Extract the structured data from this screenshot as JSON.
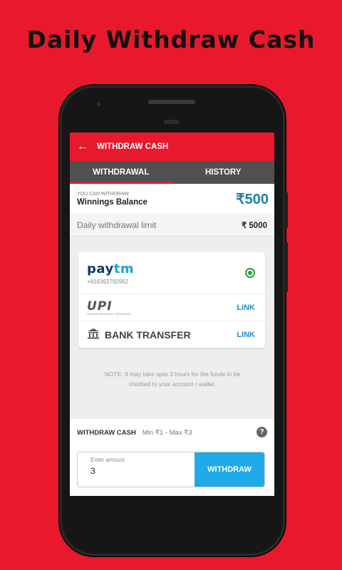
{
  "headline": "Daily Withdraw Cash",
  "appbar": {
    "back_icon": "arrow-left-icon",
    "title": "WITHDRAW CASH"
  },
  "tabs": [
    {
      "label": "WITHDRAWAL",
      "active": true
    },
    {
      "label": "HISTORY",
      "active": false
    }
  ],
  "balance": {
    "caption": "YOU CAN WITHDRAW",
    "label": "Winnings Balance",
    "amount": "₹500"
  },
  "limit": {
    "label": "Daily withdrawal limit",
    "value": "₹ 5000"
  },
  "payment_methods": [
    {
      "brand_pay": "pay",
      "brand_tm": "tm",
      "detail": "+916363792962",
      "selected": true
    },
    {
      "brand": "UPI",
      "sub": "UNIFIED PAYMENTS INTERFACE",
      "action": "LINK"
    },
    {
      "label": "BANK TRANSFER",
      "icon": "bank-icon",
      "action": "LINK"
    }
  ],
  "note": {
    "line1": "NOTE: It may take upto 3 hours for the funds to be",
    "line2": "credited to your account / wallet."
  },
  "withdraw": {
    "title": "WITHDRAW CASH",
    "range": "Min ₹1 - Max ₹3",
    "help_icon": "?",
    "input_placeholder": "Enter amount",
    "input_value": "3",
    "button_label": "WITHDRAW"
  },
  "colors": {
    "background": "#e8192c",
    "appbar": "#e8192c",
    "tabs": "#505050",
    "accent_blue": "#20a9e8",
    "balance_amount": "#1e7fae",
    "radio_selected": "#2e9e44"
  }
}
